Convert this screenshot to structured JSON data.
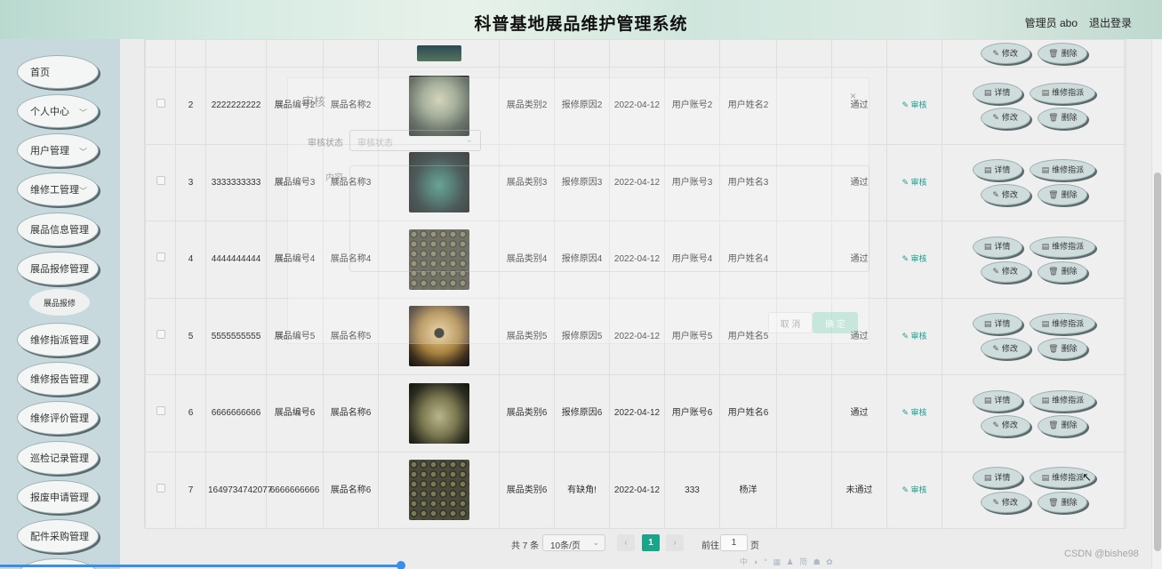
{
  "header": {
    "title": "科普基地展品维护管理系统",
    "user": "管理员 abo",
    "logout": "退出登录"
  },
  "sidebar": {
    "items": [
      {
        "label": "首页",
        "chevron": false
      },
      {
        "label": "个人中心",
        "chevron": true
      },
      {
        "label": "用户管理",
        "chevron": true
      },
      {
        "label": "维修工管理",
        "chevron": true
      },
      {
        "label": "展品信息管理",
        "chevron": false
      },
      {
        "label": "展品报修管理",
        "chevron": false
      },
      {
        "label": "维修指派管理",
        "chevron": false
      },
      {
        "label": "维修报告管理",
        "chevron": false
      },
      {
        "label": "维修评价管理",
        "chevron": false
      },
      {
        "label": "巡检记录管理",
        "chevron": false
      },
      {
        "label": "报废申请管理",
        "chevron": false
      },
      {
        "label": "配件采购管理",
        "chevron": false
      }
    ],
    "subitem": "展品报修"
  },
  "buttons": {
    "detail": "详情",
    "assign": "维修指派",
    "edit": "修改",
    "delete": "删除",
    "audit": "审核"
  },
  "table": {
    "rows": [
      {
        "idx": "2",
        "no": "2222222222",
        "code": "展品编号2",
        "name": "展品名称2",
        "category": "展品类别2",
        "reason": "报修原因2",
        "date": "2022-04-12",
        "account": "用户账号2",
        "username": "用户姓名2",
        "status": "通过"
      },
      {
        "idx": "3",
        "no": "3333333333",
        "code": "展品编号3",
        "name": "展品名称3",
        "category": "展品类别3",
        "reason": "报修原因3",
        "date": "2022-04-12",
        "account": "用户账号3",
        "username": "用户姓名3",
        "status": "通过"
      },
      {
        "idx": "4",
        "no": "4444444444",
        "code": "展品编号4",
        "name": "展品名称4",
        "category": "展品类别4",
        "reason": "报修原因4",
        "date": "2022-04-12",
        "account": "用户账号4",
        "username": "用户姓名4",
        "status": "通过"
      },
      {
        "idx": "5",
        "no": "5555555555",
        "code": "展品编号5",
        "name": "展品名称5",
        "category": "展品类别5",
        "reason": "报修原因5",
        "date": "2022-04-12",
        "account": "用户账号5",
        "username": "用户姓名5",
        "status": "通过"
      },
      {
        "idx": "6",
        "no": "6666666666",
        "code": "展品编号6",
        "name": "展品名称6",
        "category": "展品类别6",
        "reason": "报修原因6",
        "date": "2022-04-12",
        "account": "用户账号6",
        "username": "用户姓名6",
        "status": "通过"
      },
      {
        "idx": "7",
        "no": "1649734742077",
        "code": "6666666666",
        "name": "展品名称6",
        "category": "展品类别6",
        "reason": "有缺角!",
        "date": "2022-04-12",
        "account": "333",
        "username": "杨洋",
        "status": "未通过"
      }
    ]
  },
  "dialog": {
    "title": "审核",
    "close": "×",
    "status_label": "审核状态",
    "status_placeholder": "审核状态",
    "reply_label": "内容",
    "cancel": "取 消",
    "ok": "确 定"
  },
  "pagination": {
    "total": "共 7 条",
    "page_size": "10条/页",
    "prev": "‹",
    "current": "1",
    "next": "›",
    "goto": "前往",
    "goto_value": "1",
    "page_suffix": "页"
  },
  "watermark": "CSDN @bishe98",
  "ime": "中 ◗ ° ▦ ♟ 简 ☗ ✿"
}
